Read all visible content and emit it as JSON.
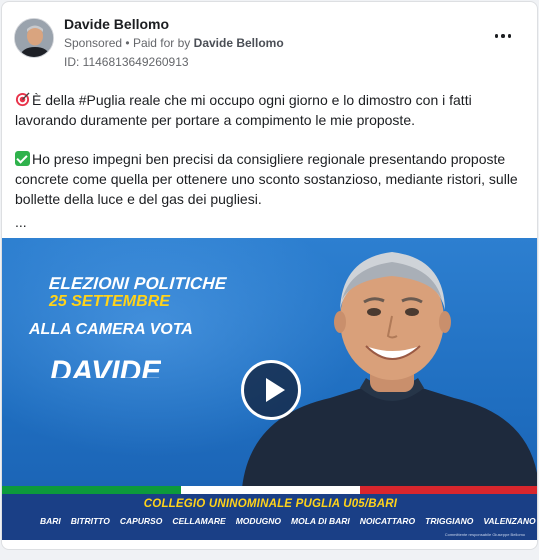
{
  "post": {
    "author": "Davide Bellomo",
    "sponsored": "Sponsored",
    "paid_prefix": "Paid for by",
    "paid_by": "Davide Bellomo",
    "ad_id": "ID: 1146813649260913",
    "more_icon": "more-horizontal-icon"
  },
  "text": {
    "para1": "È della #Puglia reale che mi occupo ogni giorno e lo dimostro con i fatti lavorando duramente per portare a compimento le mie proposte.",
    "para2": "Ho preso impegni ben precisi da consigliere regionale presentando proposte concrete come quella per ottenere uno sconto sostanzioso, mediante ristori, sulle bollette della luce e del gas dei pugliesi.",
    "ellipsis": "..."
  },
  "media": {
    "line1": "ELEZIONI POLITICHE",
    "line2": "25 SETTEMBRE",
    "line3": "ALLA CAMERA VOTA",
    "line4": "DAVIDE",
    "collegio": "COLLEGIO UNINOMINALE PUGLIA U05/BARI",
    "towns": [
      "BARI",
      "BITRITTO",
      "CAPURSO",
      "CELLAMARE",
      "MODUGNO",
      "MOLA DI BARI",
      "NOICATTARO",
      "TRIGGIANO",
      "VALENZANO"
    ],
    "committente": "Committente responsabile Giuseppe Bellomo",
    "play_icon": "play-icon"
  },
  "colors": {
    "flag_green": "#0d9a3c",
    "flag_white": "#ffffff",
    "flag_red": "#d9262d",
    "accent_yellow": "#ffd31a",
    "band_blue": "#1a3f86"
  }
}
